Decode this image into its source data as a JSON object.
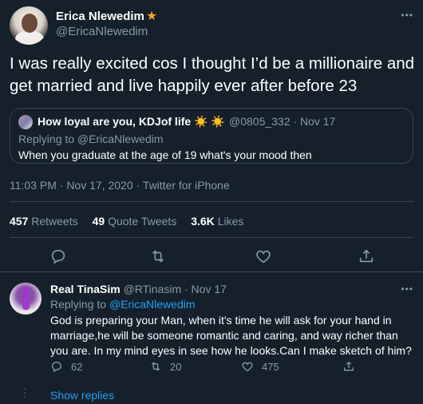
{
  "tweet": {
    "display_name": "Erica Nlewedim",
    "verified_icon": "star-icon",
    "handle": "@EricaNlewedim",
    "text": "I was really excited cos I thought I’d be a millionaire and get married and live happily ever after before 23",
    "timestamp": "11:03 PM · Nov 17, 2020 · Twitter for iPhone",
    "stats": {
      "retweets_count": "457",
      "retweets_label": "Retweets",
      "quotes_count": "49",
      "quotes_label": "Quote Tweets",
      "likes_count": "3.6K",
      "likes_label": "Likes"
    }
  },
  "quote": {
    "name": "How loyal are you, KDJof life ☀️ ☀️",
    "handle_time": "@0805_332 · Nov 17",
    "replying_to": "Replying to @EricaNlewedim",
    "text": "When you graduate at the age of 19 what's your mood then"
  },
  "reply": {
    "name": "Real TinaSim",
    "handle_time": "@RTinasim · Nov 17",
    "replying_prefix": "Replying to",
    "replying_handle": "@EricaNlewedim",
    "text": "God is preparing your Man, when it's time he will ask for your hand in marriage,he will be someone romantic and caring, and way richer than you are. In my mind eyes in see how he looks.Can I make sketch of him?",
    "replies": "62",
    "retweets": "20",
    "likes": "475"
  },
  "show_replies": "Show replies",
  "colors": {
    "background": "#15202b",
    "secondary_text": "#8899a6",
    "accent": "#1da1f2",
    "border": "#38444d"
  }
}
